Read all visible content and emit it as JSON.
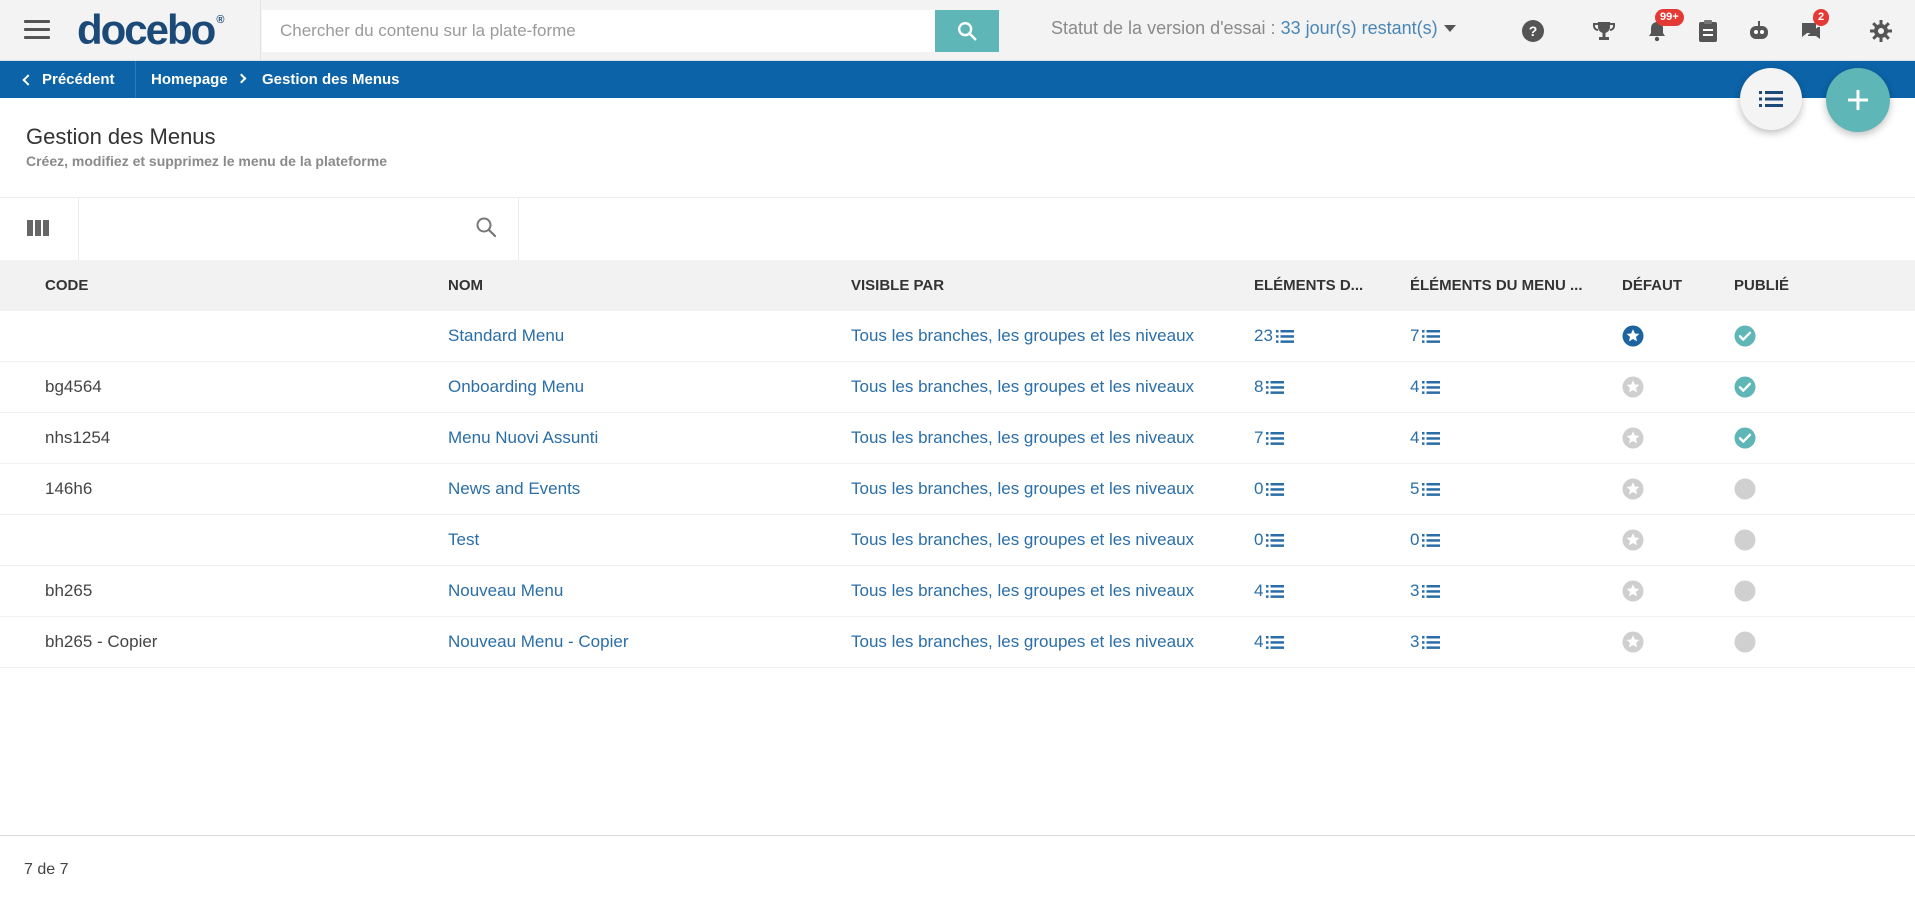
{
  "header": {
    "logo_text": "docebo",
    "logo_mark": "®",
    "search_placeholder": "Chercher du contenu sur la plate-forme",
    "trial_prefix": "Statut de la version d'essai : ",
    "trial_days": "33 jour(s) restant(s)",
    "notifications_badge": "99+",
    "messages_badge": "2",
    "icons": [
      "menu-icon",
      "search-icon",
      "help-icon",
      "trophy-icon",
      "bell-icon",
      "clipboard-icon",
      "robot-icon",
      "chat-icon",
      "gear-icon"
    ]
  },
  "breadcrumb": {
    "back_label": "Précédent",
    "home_label": "Homepage",
    "current_label": "Gestion des Menus"
  },
  "page": {
    "title": "Gestion des Menus",
    "subtitle": "Créez, modifiez et supprimez le menu de la plateforme"
  },
  "table": {
    "columns": [
      "CODE",
      "NOM",
      "VISIBLE PAR",
      "ELÉMENTS D...",
      "ÉLÉMENTS DU MENU ...",
      "DÉFAUT",
      "PUBLIÉ"
    ],
    "rows": [
      {
        "code": "",
        "nom": "Standard Menu",
        "visible": "Tous les branches, les groupes et les niveaux",
        "el1": "23",
        "el2": "7",
        "default": true,
        "published": true
      },
      {
        "code": "bg4564",
        "nom": "Onboarding Menu",
        "visible": "Tous les branches, les groupes et les niveaux",
        "el1": "8",
        "el2": "4",
        "default": false,
        "published": true
      },
      {
        "code": "nhs1254",
        "nom": "Menu Nuovi Assunti",
        "visible": "Tous les branches, les groupes et les niveaux",
        "el1": "7",
        "el2": "4",
        "default": false,
        "published": true
      },
      {
        "code": "146h6",
        "nom": "News and Events",
        "visible": "Tous les branches, les groupes et les niveaux",
        "el1": "0",
        "el2": "5",
        "default": false,
        "published": false
      },
      {
        "code": "",
        "nom": "Test",
        "visible": "Tous les branches, les groupes et les niveaux",
        "el1": "0",
        "el2": "0",
        "default": false,
        "published": false
      },
      {
        "code": "bh265",
        "nom": "Nouveau Menu",
        "visible": "Tous les branches, les groupes et les niveaux",
        "el1": "4",
        "el2": "3",
        "default": false,
        "published": false
      },
      {
        "code": "bh265 - Copier",
        "nom": "Nouveau Menu - Copier",
        "visible": "Tous les branches, les groupes et les niveaux",
        "el1": "4",
        "el2": "3",
        "default": false,
        "published": false
      }
    ]
  },
  "footer": {
    "count": "7 de 7"
  },
  "colors": {
    "brand": "#1c4a78",
    "breadcrumb_bg": "#0c63a7",
    "accent_teal": "#5fb6b6",
    "link": "#2a6ea8",
    "badge_red": "#e53935"
  }
}
